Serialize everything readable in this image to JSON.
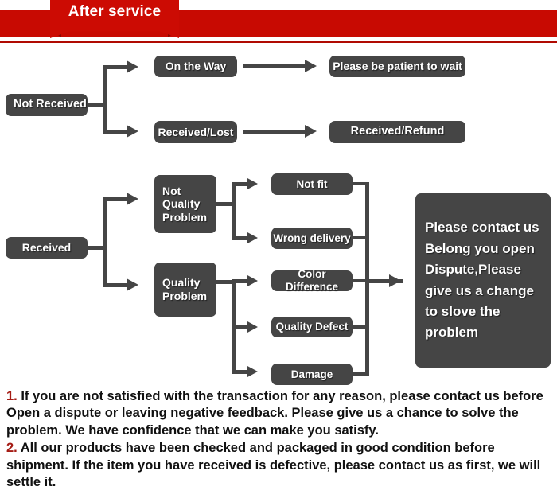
{
  "header": {
    "title": "After service",
    "bar_color": "#c80a02",
    "tab_color": "#cc0b03",
    "fold_color": "#8f0700"
  },
  "theme": {
    "box_color": "#454545",
    "box_text_color": "#ffffff",
    "accent_red": "#a51b14",
    "background": "#ffffff"
  },
  "flow_not_received": {
    "root": "Not Received",
    "branches": [
      {
        "status": "On the Way",
        "outcome": "Please be patient to wait"
      },
      {
        "status": "Received/Lost",
        "outcome": "Received/Refund"
      }
    ]
  },
  "flow_received": {
    "root": "Received",
    "categories": [
      {
        "label": "Not Quality\nProblem",
        "label_line1": "Not",
        "label_line2": "Quality",
        "label_line3": "Problem",
        "issues": [
          "Not fit",
          "Wrong delivery"
        ]
      },
      {
        "label": "Quality\nProblem",
        "label_line1": "Quality",
        "label_line2": "Problem",
        "issues": [
          "Color Difference",
          "Quality Defect",
          "Damage"
        ]
      }
    ],
    "resolution": {
      "line1": "Please contact us",
      "line2": "Belong you open",
      "line3": "Dispute,Please",
      "line4": "give us a change",
      "line5": "to slove the",
      "line6": "problem"
    }
  },
  "policy": {
    "item1_number": "1.",
    "item1_text": " If you are not satisfied with the transaction for any reason, please contact us before Open a dispute or leaving negative feedback. Please give us a chance to solve the problem. We have confidence that we can make you satisfy.",
    "item2_number": "2.",
    "item2_text": " All our products have been checked and packaged in good condition before shipment. If the item you have received is defective, please contact us as first, we will settle it."
  }
}
